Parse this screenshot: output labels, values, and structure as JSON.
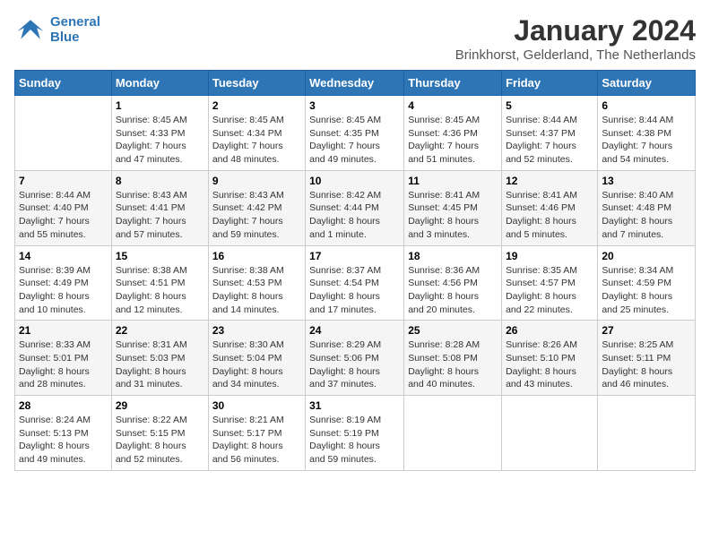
{
  "header": {
    "logo_line1": "General",
    "logo_line2": "Blue",
    "month_year": "January 2024",
    "location": "Brinkhorst, Gelderland, The Netherlands"
  },
  "weekdays": [
    "Sunday",
    "Monday",
    "Tuesday",
    "Wednesday",
    "Thursday",
    "Friday",
    "Saturday"
  ],
  "weeks": [
    [
      {
        "day": "",
        "info": ""
      },
      {
        "day": "1",
        "info": "Sunrise: 8:45 AM\nSunset: 4:33 PM\nDaylight: 7 hours\nand 47 minutes."
      },
      {
        "day": "2",
        "info": "Sunrise: 8:45 AM\nSunset: 4:34 PM\nDaylight: 7 hours\nand 48 minutes."
      },
      {
        "day": "3",
        "info": "Sunrise: 8:45 AM\nSunset: 4:35 PM\nDaylight: 7 hours\nand 49 minutes."
      },
      {
        "day": "4",
        "info": "Sunrise: 8:45 AM\nSunset: 4:36 PM\nDaylight: 7 hours\nand 51 minutes."
      },
      {
        "day": "5",
        "info": "Sunrise: 8:44 AM\nSunset: 4:37 PM\nDaylight: 7 hours\nand 52 minutes."
      },
      {
        "day": "6",
        "info": "Sunrise: 8:44 AM\nSunset: 4:38 PM\nDaylight: 7 hours\nand 54 minutes."
      }
    ],
    [
      {
        "day": "7",
        "info": "Sunrise: 8:44 AM\nSunset: 4:40 PM\nDaylight: 7 hours\nand 55 minutes."
      },
      {
        "day": "8",
        "info": "Sunrise: 8:43 AM\nSunset: 4:41 PM\nDaylight: 7 hours\nand 57 minutes."
      },
      {
        "day": "9",
        "info": "Sunrise: 8:43 AM\nSunset: 4:42 PM\nDaylight: 7 hours\nand 59 minutes."
      },
      {
        "day": "10",
        "info": "Sunrise: 8:42 AM\nSunset: 4:44 PM\nDaylight: 8 hours\nand 1 minute."
      },
      {
        "day": "11",
        "info": "Sunrise: 8:41 AM\nSunset: 4:45 PM\nDaylight: 8 hours\nand 3 minutes."
      },
      {
        "day": "12",
        "info": "Sunrise: 8:41 AM\nSunset: 4:46 PM\nDaylight: 8 hours\nand 5 minutes."
      },
      {
        "day": "13",
        "info": "Sunrise: 8:40 AM\nSunset: 4:48 PM\nDaylight: 8 hours\nand 7 minutes."
      }
    ],
    [
      {
        "day": "14",
        "info": "Sunrise: 8:39 AM\nSunset: 4:49 PM\nDaylight: 8 hours\nand 10 minutes."
      },
      {
        "day": "15",
        "info": "Sunrise: 8:38 AM\nSunset: 4:51 PM\nDaylight: 8 hours\nand 12 minutes."
      },
      {
        "day": "16",
        "info": "Sunrise: 8:38 AM\nSunset: 4:53 PM\nDaylight: 8 hours\nand 14 minutes."
      },
      {
        "day": "17",
        "info": "Sunrise: 8:37 AM\nSunset: 4:54 PM\nDaylight: 8 hours\nand 17 minutes."
      },
      {
        "day": "18",
        "info": "Sunrise: 8:36 AM\nSunset: 4:56 PM\nDaylight: 8 hours\nand 20 minutes."
      },
      {
        "day": "19",
        "info": "Sunrise: 8:35 AM\nSunset: 4:57 PM\nDaylight: 8 hours\nand 22 minutes."
      },
      {
        "day": "20",
        "info": "Sunrise: 8:34 AM\nSunset: 4:59 PM\nDaylight: 8 hours\nand 25 minutes."
      }
    ],
    [
      {
        "day": "21",
        "info": "Sunrise: 8:33 AM\nSunset: 5:01 PM\nDaylight: 8 hours\nand 28 minutes."
      },
      {
        "day": "22",
        "info": "Sunrise: 8:31 AM\nSunset: 5:03 PM\nDaylight: 8 hours\nand 31 minutes."
      },
      {
        "day": "23",
        "info": "Sunrise: 8:30 AM\nSunset: 5:04 PM\nDaylight: 8 hours\nand 34 minutes."
      },
      {
        "day": "24",
        "info": "Sunrise: 8:29 AM\nSunset: 5:06 PM\nDaylight: 8 hours\nand 37 minutes."
      },
      {
        "day": "25",
        "info": "Sunrise: 8:28 AM\nSunset: 5:08 PM\nDaylight: 8 hours\nand 40 minutes."
      },
      {
        "day": "26",
        "info": "Sunrise: 8:26 AM\nSunset: 5:10 PM\nDaylight: 8 hours\nand 43 minutes."
      },
      {
        "day": "27",
        "info": "Sunrise: 8:25 AM\nSunset: 5:11 PM\nDaylight: 8 hours\nand 46 minutes."
      }
    ],
    [
      {
        "day": "28",
        "info": "Sunrise: 8:24 AM\nSunset: 5:13 PM\nDaylight: 8 hours\nand 49 minutes."
      },
      {
        "day": "29",
        "info": "Sunrise: 8:22 AM\nSunset: 5:15 PM\nDaylight: 8 hours\nand 52 minutes."
      },
      {
        "day": "30",
        "info": "Sunrise: 8:21 AM\nSunset: 5:17 PM\nDaylight: 8 hours\nand 56 minutes."
      },
      {
        "day": "31",
        "info": "Sunrise: 8:19 AM\nSunset: 5:19 PM\nDaylight: 8 hours\nand 59 minutes."
      },
      {
        "day": "",
        "info": ""
      },
      {
        "day": "",
        "info": ""
      },
      {
        "day": "",
        "info": ""
      }
    ]
  ]
}
